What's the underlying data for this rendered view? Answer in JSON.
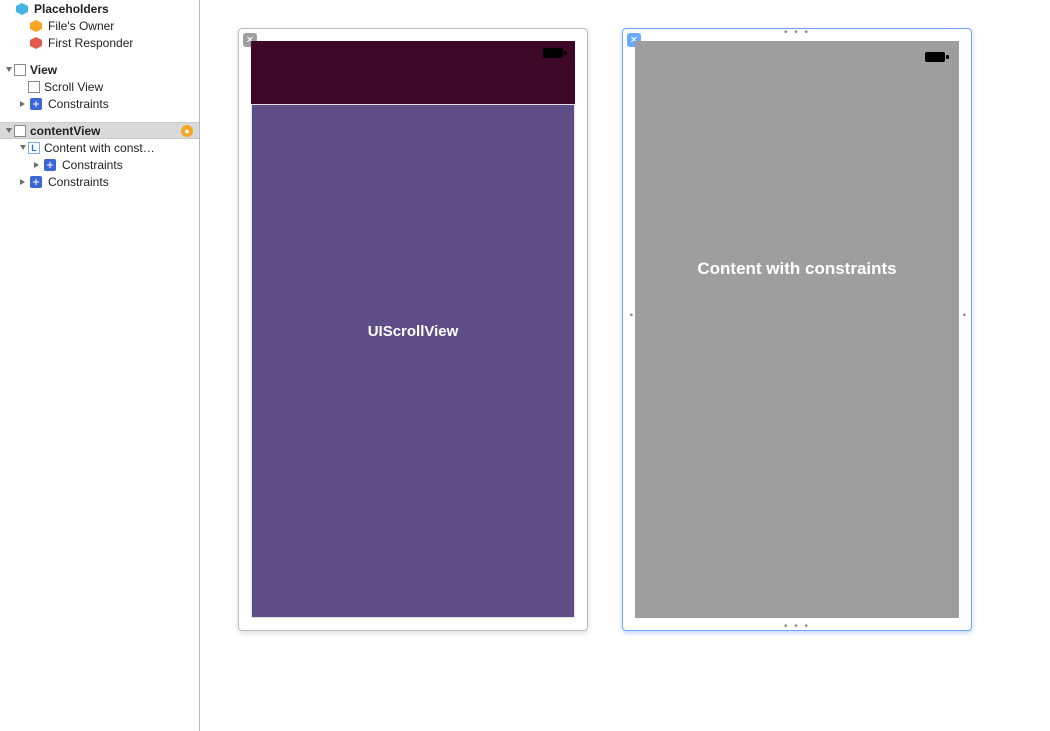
{
  "outline": {
    "placeholders_label": "Placeholders",
    "files_owner_label": "File's Owner",
    "first_responder_label": "First Responder",
    "view_label": "View",
    "scroll_view_label": "Scroll View",
    "constraints_label_1": "Constraints",
    "contentview_label": "contentView",
    "content_with_const_label": "Content with  const…",
    "constraints_label_2": "Constraints",
    "constraints_label_3": "Constraints"
  },
  "canvas": {
    "left_device": {
      "scrollview_title": "UIScrollView"
    },
    "right_device": {
      "content_title": "Content with  constraints"
    }
  }
}
